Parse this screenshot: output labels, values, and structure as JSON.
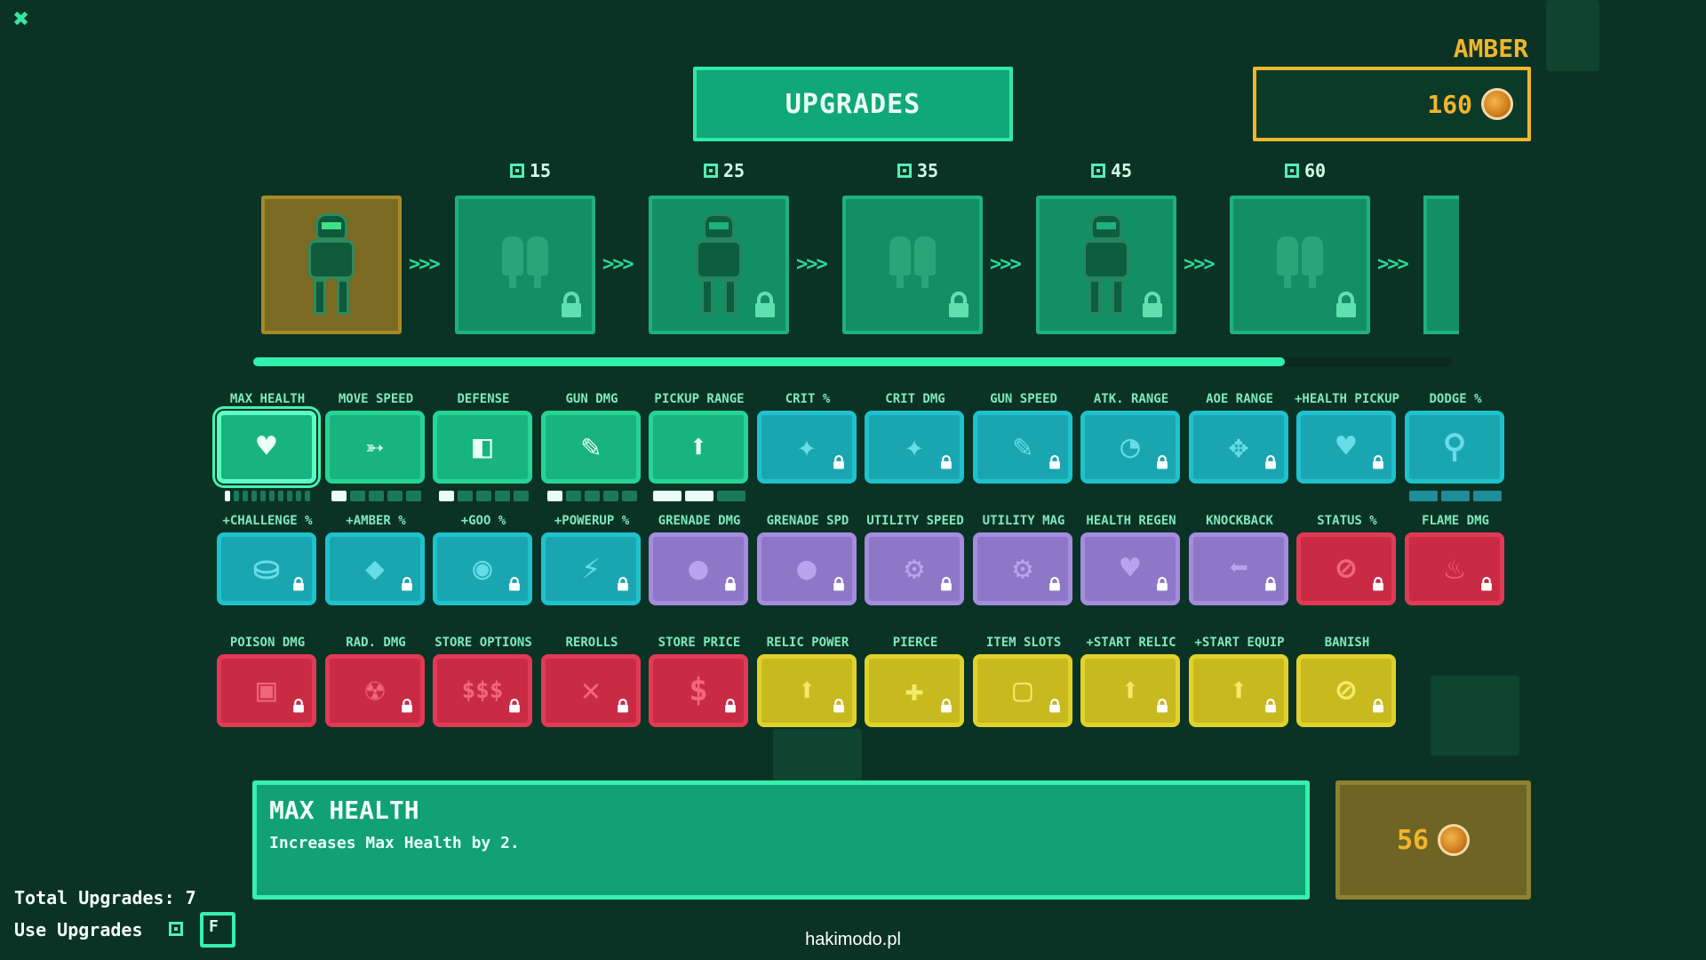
{
  "close_icon": "close-icon",
  "title": "UPGRADES",
  "currency": {
    "name": "AMBER",
    "amount": "160",
    "icon": "amber-coin-icon",
    "color": "#f2b52a"
  },
  "tiers": [
    {
      "cost": "",
      "type": "soldier",
      "locked": false,
      "active": true
    },
    {
      "cost": "15",
      "type": "boots",
      "locked": true
    },
    {
      "cost": "25",
      "type": "soldier",
      "locked": true
    },
    {
      "cost": "35",
      "type": "boots",
      "locked": true
    },
    {
      "cost": "45",
      "type": "soldier",
      "locked": true
    },
    {
      "cost": "60",
      "type": "boots",
      "locked": true
    }
  ],
  "tier_arrow": ">>>",
  "progress": 0.86,
  "upgrades": [
    [
      {
        "label": "MAX HEALTH",
        "glyph": "♥",
        "icon": "heart-icon",
        "color": "green",
        "locked": false,
        "selected": true,
        "pips": 10,
        "filled": 1
      },
      {
        "label": "MOVE SPEED",
        "glyph": "➳",
        "icon": "wing-boot-icon",
        "color": "green",
        "locked": false,
        "pips": 5,
        "filled": 1
      },
      {
        "label": "DEFENSE",
        "glyph": "◧",
        "icon": "shield-icon",
        "color": "green",
        "locked": false,
        "pips": 5,
        "filled": 1
      },
      {
        "label": "GUN DMG",
        "glyph": "✎",
        "icon": "gun-icon",
        "color": "green",
        "locked": false,
        "pips": 5,
        "filled": 1
      },
      {
        "label": "PICKUP RANGE",
        "glyph": "⬆",
        "icon": "arrow-up-icon",
        "color": "green",
        "locked": false,
        "pips": 3,
        "filled": 2
      },
      {
        "label": "CRIT %",
        "glyph": "✦",
        "icon": "crit-icon",
        "color": "blue",
        "locked": true
      },
      {
        "label": "CRIT DMG",
        "glyph": "✦",
        "icon": "crit-dmg-icon",
        "color": "blue",
        "locked": true
      },
      {
        "label": "GUN SPEED",
        "glyph": "✎",
        "icon": "gun-speed-icon",
        "color": "blue",
        "locked": true
      },
      {
        "label": "ATK. RANGE",
        "glyph": "◔",
        "icon": "range-icon",
        "color": "blue",
        "locked": true
      },
      {
        "label": "AOE RANGE",
        "glyph": "✥",
        "icon": "aoe-icon",
        "color": "blue",
        "locked": true
      },
      {
        "label": "+HEALTH PICKUP",
        "glyph": "♥",
        "icon": "health-pickup-icon",
        "color": "blue",
        "locked": true
      },
      {
        "label": "DODGE %",
        "glyph": "⚲",
        "icon": "dodge-icon",
        "color": "blue",
        "locked": false,
        "pips": 3,
        "filled": 0,
        "pipcolor": "blue"
      }
    ],
    [
      {
        "label": "+CHALLENGE %",
        "glyph": "⛀",
        "icon": "challenge-icon",
        "color": "blue",
        "locked": true
      },
      {
        "label": "+AMBER %",
        "glyph": "◆",
        "icon": "amber-bonus-icon",
        "color": "blue",
        "locked": true
      },
      {
        "label": "+GOO %",
        "glyph": "◉",
        "icon": "goo-bonus-icon",
        "color": "blue",
        "locked": true
      },
      {
        "label": "+POWERUP %",
        "glyph": "⚡",
        "icon": "powerup-icon",
        "color": "blue",
        "locked": true
      },
      {
        "label": "GRENADE DMG",
        "glyph": "●",
        "icon": "grenade-icon",
        "color": "purple",
        "locked": true
      },
      {
        "label": "GRENADE SPD",
        "glyph": "●",
        "icon": "grenade-speed-icon",
        "color": "purple",
        "locked": true
      },
      {
        "label": "UTILITY SPEED",
        "glyph": "⚙",
        "icon": "utility-speed-icon",
        "color": "purple",
        "locked": true
      },
      {
        "label": "UTILITY MAG",
        "glyph": "⚙",
        "icon": "utility-mag-icon",
        "color": "purple",
        "locked": true
      },
      {
        "label": "HEALTH REGEN",
        "glyph": "♥",
        "icon": "health-regen-icon",
        "color": "purple",
        "locked": true
      },
      {
        "label": "KNOCKBACK",
        "glyph": "⬅",
        "icon": "knockback-icon",
        "color": "purple",
        "locked": true
      },
      {
        "label": "STATUS %",
        "glyph": "⊘",
        "icon": "status-icon",
        "color": "red",
        "locked": true
      },
      {
        "label": "FLAME DMG",
        "glyph": "♨",
        "icon": "flame-icon",
        "color": "red",
        "locked": true
      }
    ],
    [
      {
        "label": "POISON DMG",
        "glyph": "▣",
        "icon": "poison-icon",
        "color": "red",
        "locked": true
      },
      {
        "label": "RAD. DMG",
        "glyph": "☢",
        "icon": "radiation-icon",
        "color": "red",
        "locked": true
      },
      {
        "label": "STORE OPTIONS",
        "glyph": "$$$",
        "icon": "store-options-icon",
        "color": "red",
        "locked": true
      },
      {
        "label": "REROLLS",
        "glyph": "✕",
        "icon": "reroll-icon",
        "color": "red",
        "locked": true
      },
      {
        "label": "STORE PRICE",
        "glyph": "$",
        "icon": "store-price-icon",
        "color": "red",
        "locked": true
      },
      {
        "label": "RELIC POWER",
        "glyph": "⬆",
        "icon": "relic-power-icon",
        "color": "yellow",
        "locked": true
      },
      {
        "label": "PIERCE",
        "glyph": "✚",
        "icon": "pierce-icon",
        "color": "yellow",
        "locked": true
      },
      {
        "label": "ITEM SLOTS",
        "glyph": "▢",
        "icon": "item-slots-icon",
        "color": "yellow",
        "locked": true
      },
      {
        "label": "+START RELIC",
        "glyph": "⬆",
        "icon": "start-relic-icon",
        "color": "yellow",
        "locked": true
      },
      {
        "label": "+START EQUIP",
        "glyph": "⬆",
        "icon": "start-equip-icon",
        "color": "yellow",
        "locked": true
      },
      {
        "label": "BANISH",
        "glyph": "⊘",
        "icon": "banish-icon",
        "color": "yellow",
        "locked": true
      }
    ]
  ],
  "description": {
    "title": "MAX HEALTH",
    "text": "Increases Max Health by 2."
  },
  "purchase": {
    "cost": "56",
    "icon": "amber-coin-icon"
  },
  "footer": {
    "total_label": "Total Upgrades: 7",
    "use_label": "Use Upgrades",
    "use_key": "F"
  },
  "watermark": "hakimodo.pl"
}
